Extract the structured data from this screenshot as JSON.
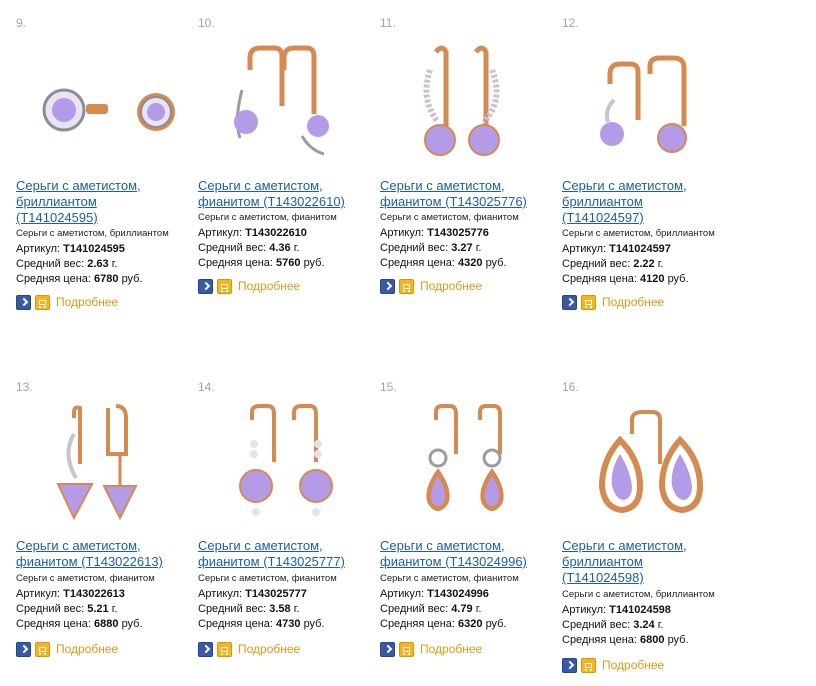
{
  "products": [
    {
      "num": "9.",
      "title_line1": "Серьги с аметистом,",
      "title_line2": "бриллиантом",
      "title_line3": "(T141024595)",
      "materials": "Серьги с аметистом, бриллиантом",
      "sku_label": "Артикул:",
      "sku": "T141024595",
      "weight_label": "Средний вес:",
      "weight": "2.63",
      "weight_unit": "г.",
      "price_label": "Средняя цена:",
      "price": "6780",
      "price_unit": "руб.",
      "more": "Подробнее"
    },
    {
      "num": "10.",
      "title_line1": "Серьги с аметистом,",
      "title_line2": "фианитом (T143022610)",
      "title_line3": "",
      "materials": "Серьги с аметистом, фианитом",
      "sku_label": "Артикул:",
      "sku": "T143022610",
      "weight_label": "Средний вес:",
      "weight": "4.36",
      "weight_unit": "г.",
      "price_label": "Средняя цена:",
      "price": "5760",
      "price_unit": "руб.",
      "more": "Подробнее"
    },
    {
      "num": "11.",
      "title_line1": "Серьги с аметистом,",
      "title_line2": "фианитом (T143025776)",
      "title_line3": "",
      "materials": "Серьги с аметистом, фианитом",
      "sku_label": "Артикул:",
      "sku": "T143025776",
      "weight_label": "Средний вес:",
      "weight": "3.27",
      "weight_unit": "г.",
      "price_label": "Средняя цена:",
      "price": "4320",
      "price_unit": "руб.",
      "more": "Подробнее"
    },
    {
      "num": "12.",
      "title_line1": "Серьги с аметистом,",
      "title_line2": "бриллиантом",
      "title_line3": "(T141024597)",
      "materials": "Серьги с аметистом, бриллиантом",
      "sku_label": "Артикул:",
      "sku": "T141024597",
      "weight_label": "Средний вес:",
      "weight": "2.22",
      "weight_unit": "г.",
      "price_label": "Средняя цена:",
      "price": "4120",
      "price_unit": "руб.",
      "more": "Подробнее"
    },
    {
      "num": "13.",
      "title_line1": "Серьги с аметистом,",
      "title_line2": "фианитом (T143022613)",
      "title_line3": "",
      "materials": "Серьги с аметистом, фианитом",
      "sku_label": "Артикул:",
      "sku": "T143022613",
      "weight_label": "Средний вес:",
      "weight": "5.21",
      "weight_unit": "г.",
      "price_label": "Средняя цена:",
      "price": "6880",
      "price_unit": "руб.",
      "more": "Подробнее"
    },
    {
      "num": "14.",
      "title_line1": "Серьги с аметистом,",
      "title_line2": "фианитом (T143025777)",
      "title_line3": "",
      "materials": "Серьги с аметистом, фианитом",
      "sku_label": "Артикул:",
      "sku": "T143025777",
      "weight_label": "Средний вес:",
      "weight": "3.58",
      "weight_unit": "г.",
      "price_label": "Средняя цена:",
      "price": "4730",
      "price_unit": "руб.",
      "more": "Подробнее"
    },
    {
      "num": "15.",
      "title_line1": "Серьги с аметистом,",
      "title_line2": "фианитом (T143024996)",
      "title_line3": "",
      "materials": "Серьги с аметистом, фианитом",
      "sku_label": "Артикул:",
      "sku": "T143024996",
      "weight_label": "Средний вес:",
      "weight": "4.79",
      "weight_unit": "г.",
      "price_label": "Средняя цена:",
      "price": "6320",
      "price_unit": "руб.",
      "more": "Подробнее"
    },
    {
      "num": "16.",
      "title_line1": "Серьги с аметистом,",
      "title_line2": "бриллиантом",
      "title_line3": "(T141024598)",
      "materials": "Серьги с аметистом, бриллиантом",
      "sku_label": "Артикул:",
      "sku": "T141024598",
      "weight_label": "Средний вес:",
      "weight": "3.24",
      "weight_unit": "г.",
      "price_label": "Средняя цена:",
      "price": "6800",
      "price_unit": "руб.",
      "more": "Подробнее"
    }
  ],
  "icons": {
    "details_button": "arrow-right-icon",
    "cart_button": "cart-icon"
  },
  "colors": {
    "link": "#1d5fa3",
    "more": "#d99a17",
    "go_button": "#3a59a4",
    "cart_button": "#f3b61e",
    "gold": "#d58a52",
    "amethyst": "#b49be8"
  }
}
